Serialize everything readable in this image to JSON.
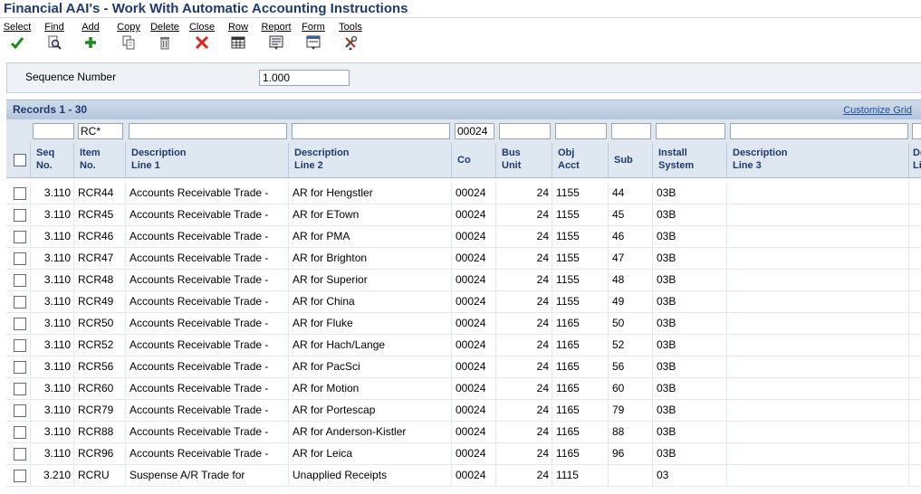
{
  "window": {
    "title": "Financial AAI's - Work With Automatic Accounting Instructions"
  },
  "toolbar": [
    {
      "label": "Select",
      "icon": "checkmark-icon",
      "color": "#1a8a1a"
    },
    {
      "label": "Find",
      "icon": "find-icon"
    },
    {
      "label": "Add",
      "icon": "plus-icon",
      "color": "#1a8a1a"
    },
    {
      "label": "Copy",
      "icon": "copy-icon"
    },
    {
      "label": "Delete",
      "icon": "trash-icon"
    },
    {
      "label": "Close",
      "icon": "close-x-icon",
      "color": "#d9261c"
    },
    {
      "label": "Row",
      "icon": "row-menu-icon"
    },
    {
      "label": "Report",
      "icon": "report-menu-icon"
    },
    {
      "label": "Form",
      "icon": "form-menu-icon"
    },
    {
      "label": "Tools",
      "icon": "tools-icon"
    }
  ],
  "header": {
    "sequence_label": "Sequence Number",
    "sequence_value": "1.000"
  },
  "grid": {
    "records_label": "Records 1 - 30",
    "customize_label": "Customize Grid",
    "qbe": {
      "item_no": "RC*",
      "co": "00024"
    },
    "columns": [
      {
        "key": "seq",
        "label": "Seq\nNo."
      },
      {
        "key": "item",
        "label": "Item\nNo."
      },
      {
        "key": "desc1",
        "label": "Description\nLine 1"
      },
      {
        "key": "desc2",
        "label": "Description\nLine 2"
      },
      {
        "key": "co",
        "label": "Co"
      },
      {
        "key": "bu",
        "label": "Bus\nUnit"
      },
      {
        "key": "obj",
        "label": "Obj\nAcct"
      },
      {
        "key": "sub",
        "label": "Sub"
      },
      {
        "key": "sys",
        "label": "Install\nSystem"
      },
      {
        "key": "desc3",
        "label": "Description\nLine 3"
      },
      {
        "key": "desc4",
        "label": "De\nLi"
      }
    ],
    "rows": [
      {
        "seq": "3.110",
        "item": "RCR44",
        "desc1": "Accounts Receivable Trade  -",
        "desc2": "AR for Hengstler",
        "co": "00024",
        "bu": "24",
        "obj": "1155",
        "sub": "44",
        "sys": "03B"
      },
      {
        "seq": "3.110",
        "item": "RCR45",
        "desc1": "Accounts Receivable Trade  -",
        "desc2": "AR for ETown",
        "co": "00024",
        "bu": "24",
        "obj": "1155",
        "sub": "45",
        "sys": "03B"
      },
      {
        "seq": "3.110",
        "item": "RCR46",
        "desc1": "Accounts Receivable Trade  -",
        "desc2": "AR for PMA",
        "co": "00024",
        "bu": "24",
        "obj": "1155",
        "sub": "46",
        "sys": "03B"
      },
      {
        "seq": "3.110",
        "item": "RCR47",
        "desc1": "Accounts Receivable Trade  -",
        "desc2": "AR for Brighton",
        "co": "00024",
        "bu": "24",
        "obj": "1155",
        "sub": "47",
        "sys": "03B"
      },
      {
        "seq": "3.110",
        "item": "RCR48",
        "desc1": "Accounts Receivable Trade  -",
        "desc2": "AR for Superior",
        "co": "00024",
        "bu": "24",
        "obj": "1155",
        "sub": "48",
        "sys": "03B"
      },
      {
        "seq": "3.110",
        "item": "RCR49",
        "desc1": "Accounts Receivable Trade  -",
        "desc2": "AR for China",
        "co": "00024",
        "bu": "24",
        "obj": "1155",
        "sub": "49",
        "sys": "03B"
      },
      {
        "seq": "3.110",
        "item": "RCR50",
        "desc1": "Accounts Receivable Trade  -",
        "desc2": "AR for Fluke",
        "co": "00024",
        "bu": "24",
        "obj": "1165",
        "sub": "50",
        "sys": "03B"
      },
      {
        "seq": "3.110",
        "item": "RCR52",
        "desc1": "Accounts Receivable Trade  -",
        "desc2": "AR for Hach/Lange",
        "co": "00024",
        "bu": "24",
        "obj": "1165",
        "sub": "52",
        "sys": "03B"
      },
      {
        "seq": "3.110",
        "item": "RCR56",
        "desc1": "Accounts Receivable Trade  -",
        "desc2": "AR for PacSci",
        "co": "00024",
        "bu": "24",
        "obj": "1165",
        "sub": "56",
        "sys": "03B"
      },
      {
        "seq": "3.110",
        "item": "RCR60",
        "desc1": "Accounts Receivable Trade  -",
        "desc2": "AR for Motion",
        "co": "00024",
        "bu": "24",
        "obj": "1165",
        "sub": "60",
        "sys": "03B"
      },
      {
        "seq": "3.110",
        "item": "RCR79",
        "desc1": "Accounts Receivable Trade  -",
        "desc2": "AR for Portescap",
        "co": "00024",
        "bu": "24",
        "obj": "1165",
        "sub": "79",
        "sys": "03B"
      },
      {
        "seq": "3.110",
        "item": "RCR88",
        "desc1": "Accounts Receivable Trade  -",
        "desc2": "AR for Anderson-Kistler",
        "co": "00024",
        "bu": "24",
        "obj": "1165",
        "sub": "88",
        "sys": "03B"
      },
      {
        "seq": "3.110",
        "item": "RCR96",
        "desc1": "Accounts Receivable Trade  -",
        "desc2": "AR for Leica",
        "co": "00024",
        "bu": "24",
        "obj": "1165",
        "sub": "96",
        "sys": "03B"
      },
      {
        "seq": "3.210",
        "item": "RCRU",
        "desc1": "Suspense A/R Trade for",
        "desc2": "Unapplied Receipts",
        "co": "00024",
        "bu": "24",
        "obj": "1115",
        "sub": "",
        "sys": "03"
      }
    ]
  }
}
